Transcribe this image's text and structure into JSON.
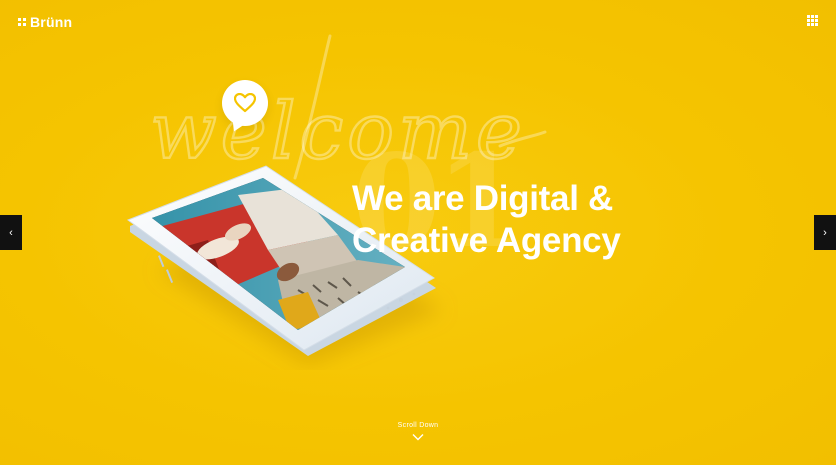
{
  "brand": {
    "name": "Brünn"
  },
  "hero": {
    "script_word": "welcome",
    "slide_number": "01",
    "headline_line1": "We are Digital &",
    "headline_line2": "Creative Agency"
  },
  "nav": {
    "prev_arrow": "‹",
    "next_arrow": "›"
  },
  "scroll": {
    "label": "Scroll Down"
  },
  "colors": {
    "background": "#F5C400",
    "text": "#FFFFFF",
    "arrow_bg": "#111111",
    "phone_body": "#EEF3F8",
    "heart": "#F5C400"
  },
  "icons": {
    "logo": "dots-logo-icon",
    "menu": "grid-menu-icon",
    "heart": "heart-icon",
    "scroll": "chevron-down-icon"
  }
}
